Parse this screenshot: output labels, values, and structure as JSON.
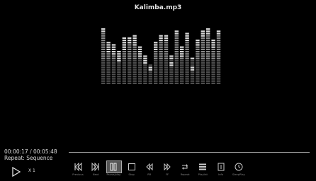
{
  "player": {
    "title": "Kalimba.mp3",
    "time": "00:00:17 / 00:05:48",
    "repeat": "Repeat: Sequence",
    "speed": "X 1"
  },
  "visualizer": {
    "levels": [
      0.95,
      0.63,
      0.58,
      0.45,
      0.66,
      0.78,
      0.74,
      0.53,
      0.42,
      0.3,
      0.67,
      0.79,
      0.82,
      0.38,
      0.92,
      0.52,
      0.82,
      0.3,
      0.72,
      0.89,
      0.94,
      0.68,
      0.92
    ],
    "peaks": [
      0.96,
      0.74,
      0.68,
      0.57,
      0.8,
      0.82,
      0.86,
      0.66,
      0.5,
      0.34,
      0.74,
      0.84,
      0.86,
      0.5,
      0.94,
      0.64,
      0.9,
      0.48,
      0.78,
      0.92,
      0.96,
      0.76,
      0.94
    ]
  },
  "controls": [
    {
      "name": "previous-button",
      "icon": "skip-back-icon",
      "label": "Previous"
    },
    {
      "name": "next-button",
      "icon": "skip-forward-icon",
      "label": "Next"
    },
    {
      "name": "pause-button",
      "icon": "pause-icon",
      "label": "Pause/play",
      "selected": true
    },
    {
      "name": "stop-button",
      "icon": "stop-icon",
      "label": "Stop"
    },
    {
      "name": "rewind-button",
      "icon": "rewind-icon",
      "label": "RR"
    },
    {
      "name": "fast-forward-button",
      "icon": "fast-forward-icon",
      "label": "FF"
    },
    {
      "name": "repeat-button",
      "icon": "repeat-icon",
      "label": "Repeat"
    },
    {
      "name": "playlist-button",
      "icon": "playlist-icon",
      "label": "Playlist"
    },
    {
      "name": "info-button",
      "icon": "info-icon",
      "label": "Info"
    },
    {
      "name": "sleep-timer-button",
      "icon": "clock-icon",
      "label": "SleepPlay"
    }
  ],
  "colors": {
    "background": "#000000",
    "bar_light": "#d8d8d8",
    "bar_dark": "#5a5a5a",
    "text": "#dddddd"
  }
}
